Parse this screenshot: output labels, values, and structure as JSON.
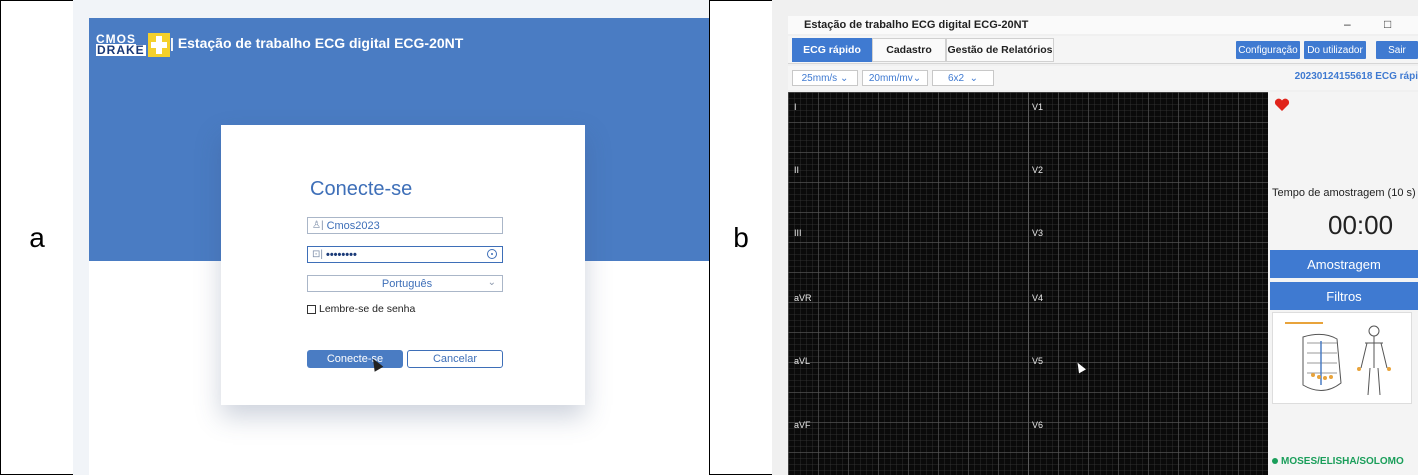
{
  "panel_a": {
    "label": "a",
    "logo_line1": "CMOS",
    "logo_line2": "DRAKE",
    "app_title": "Estação de trabalho ECG digital ECG-20NT",
    "login_title": "Conecte-se",
    "username_value": "Cmos2023",
    "password_value": "••••••••",
    "language_value": "Português",
    "remember_label": "Lembre-se de senha",
    "connect_button": "Conecte-se",
    "cancel_button": "Cancelar"
  },
  "panel_b": {
    "label": "b",
    "window_title": "Estação de trabalho ECG digital ECG-20NT",
    "window_minimize": "–",
    "window_maximize": "□",
    "tabs": [
      "ECG rápido",
      "Cadastro",
      "Gestão de Relatórios"
    ],
    "toolbar_buttons": [
      "Configuração",
      "Do utilizador",
      "Sair"
    ],
    "speed_select": "25mm/s",
    "gain_select": "20mm/mv",
    "layout_select": "6x2",
    "record_id": "20230124155618  ECG rápi",
    "leads_left": [
      "I",
      "II",
      "III",
      "aVR",
      "aVL",
      "aVF"
    ],
    "leads_right": [
      "V1",
      "V2",
      "V3",
      "V4",
      "V5",
      "V6"
    ],
    "sample_label": "Tempo de amostragem (10 s)",
    "timer": "00:00",
    "sample_button": "Amostragem",
    "filter_button": "Filtros",
    "patient_name": "MOSES/ELISHA/SOLOMO",
    "colors": {
      "accent": "#3f7ad1",
      "heart": "#e0241b",
      "patient": "#1a9e5a"
    }
  }
}
